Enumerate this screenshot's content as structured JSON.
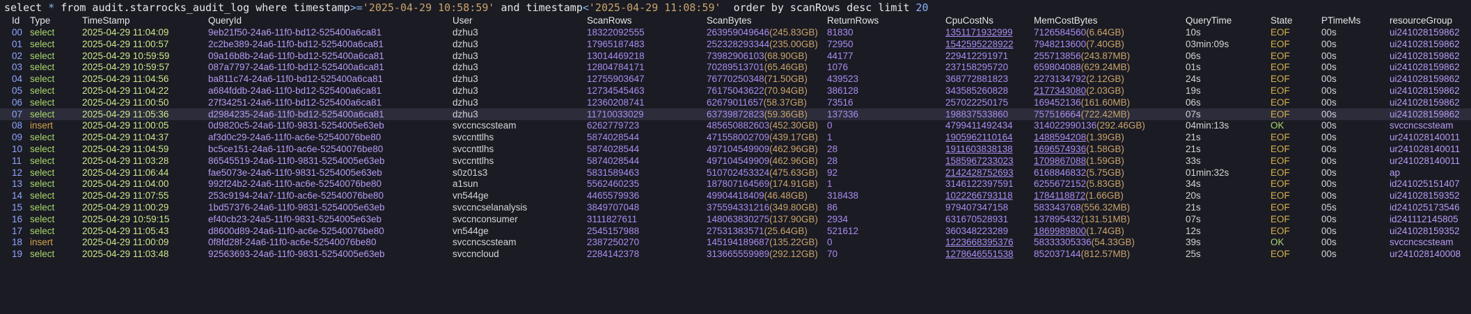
{
  "query": {
    "prefix": "select ",
    "star": "*",
    "from": " from audit.starrocks_audit_log where timestamp",
    "op1": ">=",
    "str1": "'2025-04-29 10:58:59'",
    "and": " and timestamp",
    "op2": "<",
    "str2": "'2025-04-29 11:08:59'",
    "order": "  order by scanRows desc limit ",
    "limit": "20"
  },
  "headers": {
    "id": "Id",
    "type": "Type",
    "ts": "TimeStamp",
    "qid": "QueryId",
    "user": "User",
    "srows": "ScanRows",
    "sbytes": "ScanBytes",
    "rrows": "ReturnRows",
    "cpu": "CpuCostNs",
    "mem": "MemCostBytes",
    "qtime": "QueryTime",
    "state": "State",
    "ptime": "PTimeMs",
    "rg": "resourceGroup"
  },
  "selected_row": 7,
  "rows": [
    {
      "id": "00",
      "type": "select",
      "ts": "2025-04-29 11:04:09",
      "qid": "9eb21f50-24a6-11f0-bd12-525400a6ca81",
      "user": "dzhu3",
      "srows": "18322092555",
      "sbytes": "263959049646",
      "sbytes_h": "(245.83GB)",
      "rrows": "81830",
      "cpu": "1351171932999",
      "mem": "7126584560",
      "mem_h": "(6.64GB)",
      "qtime": "10s",
      "state": "EOF",
      "ptime": "00s",
      "rg": "ui241028159862",
      "cpu_ul": true,
      "mem_ul": false
    },
    {
      "id": "01",
      "type": "select",
      "ts": "2025-04-29 11:00:57",
      "qid": "2c2be389-24a6-11f0-bd12-525400a6ca81",
      "user": "dzhu3",
      "srows": "17965187483",
      "sbytes": "252328293344",
      "sbytes_h": "(235.00GB)",
      "rrows": "72950",
      "cpu": "1542595228922",
      "mem": "7948213600",
      "mem_h": "(7.40GB)",
      "qtime": "03min:09s",
      "state": "EOF",
      "ptime": "00s",
      "rg": "ui241028159862",
      "cpu_ul": true,
      "mem_ul": false
    },
    {
      "id": "02",
      "type": "select",
      "ts": "2025-04-29 10:59:59",
      "qid": "09a16b8b-24a6-11f0-bd12-525400a6ca81",
      "user": "dzhu3",
      "srows": "13014469218",
      "sbytes": "73982906103",
      "sbytes_h": "(68.90GB)",
      "rrows": "44177",
      "cpu": "229412291971",
      "mem": "255713856",
      "mem_h": "(243.87MB)",
      "qtime": "06s",
      "state": "EOF",
      "ptime": "00s",
      "rg": "ui241028159862",
      "cpu_ul": false,
      "mem_ul": false
    },
    {
      "id": "03",
      "type": "select",
      "ts": "2025-04-29 10:59:57",
      "qid": "087a7797-24a6-11f0-bd12-525400a6ca81",
      "user": "dzhu3",
      "srows": "12804784171",
      "sbytes": "70289513701",
      "sbytes_h": "(65.46GB)",
      "rrows": "1076",
      "cpu": "237158295720",
      "mem": "659804088",
      "mem_h": "(629.24MB)",
      "qtime": "01s",
      "state": "EOF",
      "ptime": "00s",
      "rg": "ui241028159862",
      "cpu_ul": false,
      "mem_ul": false
    },
    {
      "id": "04",
      "type": "select",
      "ts": "2025-04-29 11:04:56",
      "qid": "ba811c74-24a6-11f0-bd12-525400a6ca81",
      "user": "dzhu3",
      "srows": "12755903647",
      "sbytes": "76770250348",
      "sbytes_h": "(71.50GB)",
      "rrows": "439523",
      "cpu": "368772881823",
      "mem": "2273134792",
      "mem_h": "(2.12GB)",
      "qtime": "24s",
      "state": "EOF",
      "ptime": "00s",
      "rg": "ui241028159862",
      "cpu_ul": false,
      "mem_ul": false
    },
    {
      "id": "05",
      "type": "select",
      "ts": "2025-04-29 11:04:22",
      "qid": "a684fddb-24a6-11f0-bd12-525400a6ca81",
      "user": "dzhu3",
      "srows": "12734545463",
      "sbytes": "76175043622",
      "sbytes_h": "(70.94GB)",
      "rrows": "386128",
      "cpu": "343585260828",
      "mem": "2177343080",
      "mem_h": "(2.03GB)",
      "qtime": "19s",
      "state": "EOF",
      "ptime": "00s",
      "rg": "ui241028159862",
      "cpu_ul": false,
      "mem_ul": true
    },
    {
      "id": "06",
      "type": "select",
      "ts": "2025-04-29 11:00:50",
      "qid": "27f34251-24a6-11f0-bd12-525400a6ca81",
      "user": "dzhu3",
      "srows": "12360208741",
      "sbytes": "62679011657",
      "sbytes_h": "(58.37GB)",
      "rrows": "73516",
      "cpu": "257022250175",
      "mem": "169452136",
      "mem_h": "(161.60MB)",
      "qtime": "06s",
      "state": "EOF",
      "ptime": "00s",
      "rg": "ui241028159862",
      "cpu_ul": false,
      "mem_ul": false
    },
    {
      "id": "07",
      "type": "select",
      "ts": "2025-04-29 11:05:36",
      "qid": "d2984235-24a6-11f0-bd12-525400a6ca81",
      "user": "dzhu3",
      "srows": "11710033029",
      "sbytes": "63739872823",
      "sbytes_h": "(59.36GB)",
      "rrows": "137336",
      "cpu": "198837533860",
      "mem": "757516664",
      "mem_h": "(722.42MB)",
      "qtime": "07s",
      "state": "EOF",
      "ptime": "00s",
      "rg": "ui241028159862",
      "cpu_ul": false,
      "mem_ul": false
    },
    {
      "id": "08",
      "type": "insert",
      "ts": "2025-04-29 11:00:05",
      "qid": "0d9820c5-24a6-11f0-9831-5254005e63eb",
      "user": "svccncscsteam",
      "srows": "6262779723",
      "sbytes": "485650882603",
      "sbytes_h": "(452.30GB)",
      "rrows": "0",
      "cpu": "4799411492434",
      "mem": "314022990136",
      "mem_h": "(292.46GB)",
      "qtime": "04min:13s",
      "state": "OK",
      "ptime": "00s",
      "rg": "svccncscsteam",
      "cpu_ul": false,
      "mem_ul": false
    },
    {
      "id": "09",
      "type": "select",
      "ts": "2025-04-29 11:04:37",
      "qid": "af3d0c29-24a6-11f0-ac6e-52540076be80",
      "user": "svccnttlhs",
      "srows": "5874028544",
      "sbytes": "471558002709",
      "sbytes_h": "(439.17GB)",
      "rrows": "1",
      "cpu": "1905962110164",
      "mem": "1488594208",
      "mem_h": "(1.39GB)",
      "qtime": "21s",
      "state": "EOF",
      "ptime": "00s",
      "rg": "ur241028140011",
      "cpu_ul": true,
      "mem_ul": true
    },
    {
      "id": "10",
      "type": "select",
      "ts": "2025-04-29 11:04:59",
      "qid": "bc5ce151-24a6-11f0-ac6e-52540076be80",
      "user": "svccnttlhs",
      "srows": "5874028544",
      "sbytes": "497104549909",
      "sbytes_h": "(462.96GB)",
      "rrows": "28",
      "cpu": "1911603838138",
      "mem": "1696574936",
      "mem_h": "(1.58GB)",
      "qtime": "21s",
      "state": "EOF",
      "ptime": "00s",
      "rg": "ur241028140011",
      "cpu_ul": true,
      "mem_ul": true
    },
    {
      "id": "11",
      "type": "select",
      "ts": "2025-04-29 11:03:28",
      "qid": "86545519-24a6-11f0-9831-5254005e63eb",
      "user": "svccnttlhs",
      "srows": "5874028544",
      "sbytes": "497104549909",
      "sbytes_h": "(462.96GB)",
      "rrows": "28",
      "cpu": "1585967233023",
      "mem": "1709867088",
      "mem_h": "(1.59GB)",
      "qtime": "33s",
      "state": "EOF",
      "ptime": "00s",
      "rg": "ur241028140011",
      "cpu_ul": true,
      "mem_ul": true
    },
    {
      "id": "12",
      "type": "select",
      "ts": "2025-04-29 11:06:44",
      "qid": "fae5073e-24a6-11f0-9831-5254005e63eb",
      "user": "s0z01s3",
      "srows": "5831589463",
      "sbytes": "510702453324",
      "sbytes_h": "(475.63GB)",
      "rrows": "92",
      "cpu": "2142428752693",
      "mem": "6168846832",
      "mem_h": "(5.75GB)",
      "qtime": "01min:32s",
      "state": "EOF",
      "ptime": "00s",
      "rg": "ap",
      "cpu_ul": true,
      "mem_ul": false
    },
    {
      "id": "13",
      "type": "select",
      "ts": "2025-04-29 11:04:00",
      "qid": "992f24b2-24a6-11f0-ac6e-52540076be80",
      "user": "a1sun",
      "srows": "5562460235",
      "sbytes": "187807164569",
      "sbytes_h": "(174.91GB)",
      "rrows": "1",
      "cpu": "3146122397591",
      "mem": "6255672152",
      "mem_h": "(5.83GB)",
      "qtime": "34s",
      "state": "EOF",
      "ptime": "00s",
      "rg": "id241025151407",
      "cpu_ul": false,
      "mem_ul": false
    },
    {
      "id": "14",
      "type": "select",
      "ts": "2025-04-29 11:07:55",
      "qid": "253c9194-24a7-11f0-ac6e-52540076be80",
      "user": "vn544ge",
      "srows": "4465579936",
      "sbytes": "49904418409",
      "sbytes_h": "(46.48GB)",
      "rrows": "318438",
      "cpu": "1022266793118",
      "mem": "1784118872",
      "mem_h": "(1.66GB)",
      "qtime": "20s",
      "state": "EOF",
      "ptime": "00s",
      "rg": "ui241028159352",
      "cpu_ul": true,
      "mem_ul": true
    },
    {
      "id": "15",
      "type": "select",
      "ts": "2025-04-29 11:00:29",
      "qid": "1bd57376-24a6-11f0-9831-5254005e63eb",
      "user": "svccncselanalysis",
      "srows": "3849707048",
      "sbytes": "375594331216",
      "sbytes_h": "(349.80GB)",
      "rrows": "86",
      "cpu": "979407347158",
      "mem": "583343768",
      "mem_h": "(556.32MB)",
      "qtime": "21s",
      "state": "EOF",
      "ptime": "05s",
      "rg": "id241025173546",
      "cpu_ul": false,
      "mem_ul": false
    },
    {
      "id": "16",
      "type": "select",
      "ts": "2025-04-29 10:59:15",
      "qid": "ef40cb23-24a5-11f0-9831-5254005e63eb",
      "user": "svccnconsumer",
      "srows": "3111827611",
      "sbytes": "148063830275",
      "sbytes_h": "(137.90GB)",
      "rrows": "2934",
      "cpu": "631670528931",
      "mem": "137895432",
      "mem_h": "(131.51MB)",
      "qtime": "07s",
      "state": "EOF",
      "ptime": "00s",
      "rg": "id241112145805",
      "cpu_ul": false,
      "mem_ul": false
    },
    {
      "id": "17",
      "type": "select",
      "ts": "2025-04-29 11:05:43",
      "qid": "d8600d89-24a6-11f0-ac6e-52540076be80",
      "user": "vn544ge",
      "srows": "2545157988",
      "sbytes": "27531383571",
      "sbytes_h": "(25.64GB)",
      "rrows": "521612",
      "cpu": "360348223289",
      "mem": "1869989800",
      "mem_h": "(1.74GB)",
      "qtime": "12s",
      "state": "EOF",
      "ptime": "00s",
      "rg": "ui241028159352",
      "cpu_ul": false,
      "mem_ul": true
    },
    {
      "id": "18",
      "type": "insert",
      "ts": "2025-04-29 11:00:09",
      "qid": "0f8fd28f-24a6-11f0-ac6e-52540076be80",
      "user": "svccncscsteam",
      "srows": "2387250270",
      "sbytes": "145194189687",
      "sbytes_h": "(135.22GB)",
      "rrows": "0",
      "cpu": "1223668395376",
      "mem": "58333305336",
      "mem_h": "(54.33GB)",
      "qtime": "39s",
      "state": "OK",
      "ptime": "00s",
      "rg": "svccncscsteam",
      "cpu_ul": true,
      "mem_ul": false
    },
    {
      "id": "19",
      "type": "select",
      "ts": "2025-04-29 11:03:48",
      "qid": "92563693-24a6-11f0-9831-5254005e63eb",
      "user": "svccncloud",
      "srows": "2284142378",
      "sbytes": "313665559989",
      "sbytes_h": "(292.12GB)",
      "rrows": "70",
      "cpu": "1278646551538",
      "mem": "852037144",
      "mem_h": "(812.57MB)",
      "qtime": "25s",
      "state": "EOF",
      "ptime": "00s",
      "rg": "ur241028140008",
      "cpu_ul": true,
      "mem_ul": false
    }
  ]
}
